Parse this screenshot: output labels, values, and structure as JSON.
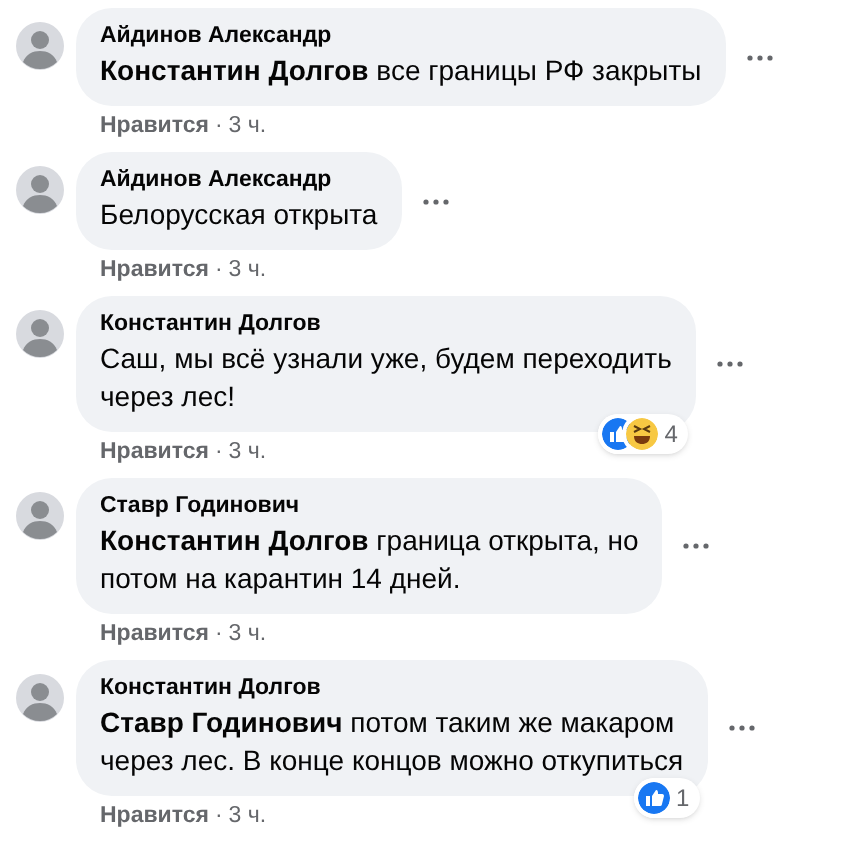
{
  "comments": [
    {
      "author": "Айдинов Александр",
      "text": "**Константин Долгов** все границы РФ закрыты",
      "like_label": "Нравится",
      "separator": "·",
      "time": "3 ч."
    },
    {
      "author": "Айдинов Александр",
      "text": "Белорусская открыта",
      "like_label": "Нравится",
      "separator": "·",
      "time": "3 ч."
    },
    {
      "author": "Константин Долгов",
      "text": "Саш, мы всё узнали уже, будем переходить\nчерез лес!",
      "like_label": "Нравится",
      "separator": "·",
      "time": "3 ч.",
      "reactions": [
        {
          "kind": "like"
        },
        {
          "kind": "haha"
        }
      ],
      "reaction_count": "4"
    },
    {
      "author": "Ставр Годинович",
      "text": "**Константин Долгов** граница открыта, но\nпотом на карантин 14 дней.",
      "like_label": "Нравится",
      "separator": "·",
      "time": "3 ч."
    },
    {
      "author": "Константин Долгов",
      "text": "**Ставр Годинович** потом таким же макаром\nчерез лес. В конце концов можно откупиться",
      "like_label": "Нравится",
      "separator": "·",
      "time": "3 ч.",
      "reactions": [
        {
          "kind": "like"
        }
      ],
      "reaction_count": "1"
    }
  ]
}
